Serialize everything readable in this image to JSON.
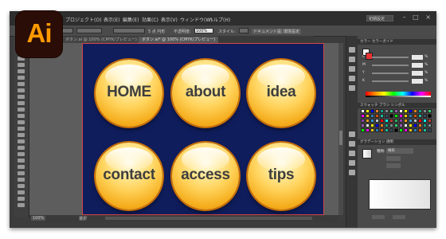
{
  "app": {
    "logo_text": "Ai",
    "logo_bg": "#2b0d07",
    "logo_color": "#ff9a00"
  },
  "menubar": {
    "items": [
      "プロジェクト(O)",
      "表示(E)",
      "編集(E)",
      "効果(C)",
      "表示(V)",
      "ウィンドウ(W)",
      "ヘルプ(H)"
    ],
    "workspace": "初期設定",
    "window_buttons": "– □ ×"
  },
  "controlbar": {
    "brush_label": "5 点 円形",
    "opacity_label": "不透明度:",
    "opacity_value": "100%",
    "style_label": "スタイル:",
    "doc_setup": "ドキュメント設定",
    "prefs": "環境設定"
  },
  "tabs": [
    {
      "label": "ボタン.ai @ 100% (CMYK/プレビュー)",
      "active": false
    },
    {
      "label": "ボタン.ai* @ 100% (CMYK/プレビュー)",
      "active": true
    }
  ],
  "buttons": [
    {
      "label": "HOME"
    },
    {
      "label": "about"
    },
    {
      "label": "idea"
    },
    {
      "label": "contact"
    },
    {
      "label": "access"
    },
    {
      "label": "tips"
    }
  ],
  "statusbar": {
    "zoom": "100%",
    "mode": "選択"
  },
  "panels": {
    "color_head": "カラー  カラーガイド",
    "cmyk_rows": [
      {
        "ch": "C",
        "pct": "%"
      },
      {
        "ch": "M",
        "pct": "%"
      },
      {
        "ch": "Y",
        "pct": "%"
      },
      {
        "ch": "K",
        "pct": "%"
      }
    ],
    "swatch_head": "スウォッチ  ブラシ  シンボル",
    "stroke_head": "グラデーション  透明",
    "grad_type_label": "種類:",
    "grad_type_value": "線形"
  },
  "colors": {
    "artboard": "#0f1d5c",
    "canvas": "#5d5d5d",
    "ui_dark": "#3c3c3c",
    "button_orange": "#f5ae1e",
    "button_label": "#3e3e3e"
  }
}
